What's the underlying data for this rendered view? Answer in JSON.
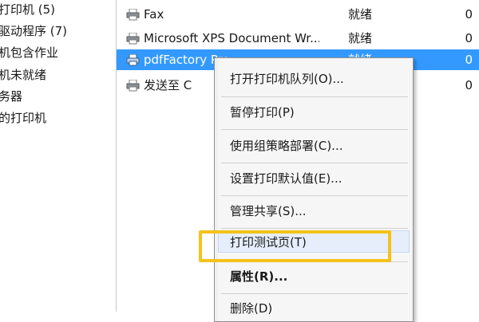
{
  "nav": {
    "items": [
      {
        "label": "打印机 (5)"
      },
      {
        "label": "驱动程序 (7)"
      },
      {
        "label": "机包含作业"
      },
      {
        "label": "机未就绪"
      },
      {
        "label": "务器"
      },
      {
        "label": "的打印机"
      }
    ]
  },
  "printers": [
    {
      "name": "Fax",
      "status": "就绪",
      "count": "0",
      "selected": false
    },
    {
      "name": "Microsoft XPS Document Wr...",
      "status": "就绪",
      "count": "0",
      "selected": false
    },
    {
      "name": "pdfFactory Pro",
      "status": "就绪",
      "count": "0",
      "selected": true
    },
    {
      "name": "发送至 C",
      "status": "",
      "count": "0",
      "selected": false
    }
  ],
  "context_menu": {
    "items": [
      {
        "label": "打开打印机队列(O)..."
      },
      {
        "label": "暂停打印(P)"
      },
      {
        "label": "使用组策略部署(C)..."
      },
      {
        "label": "设置打印默认值(E)..."
      },
      {
        "label": "管理共享(S)..."
      },
      {
        "label": "打印测试页(T)"
      },
      {
        "label": "属性(R)..."
      },
      {
        "label": "删除(D)"
      }
    ],
    "highlighted": "打印测试页(T)"
  },
  "colors": {
    "selection": "#3399ff",
    "highlight_box": "#f4c21a"
  },
  "icons": {
    "printer": "printer-icon"
  }
}
